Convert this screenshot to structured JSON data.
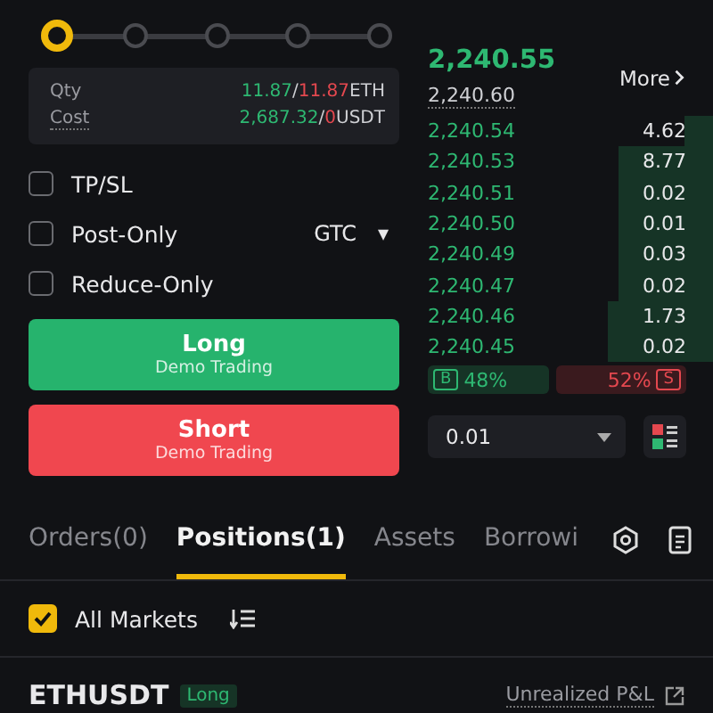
{
  "leverage_slider": {
    "level": 0
  },
  "summary": {
    "rows": [
      {
        "label": "Qty",
        "long": "11.87",
        "sep": "/",
        "short": "11.87",
        "unit": "ETH"
      },
      {
        "label": "Cost",
        "long": "2,687.32",
        "sep": "/",
        "short": "0",
        "unit": "USDT"
      }
    ]
  },
  "options": [
    {
      "label": "TP/SL",
      "checked": false
    },
    {
      "label": "Post-Only",
      "checked": false,
      "select": {
        "value": "GTC",
        "caret": "▾"
      }
    },
    {
      "label": "Reduce-Only",
      "checked": false
    }
  ],
  "actions": [
    {
      "kind": "long",
      "label": "Long",
      "sublabel": "Demo Trading"
    },
    {
      "kind": "short",
      "label": "Short",
      "sublabel": "Demo Trading"
    }
  ],
  "order_book": {
    "last_price": "2,240.55",
    "mark_price": "2,240.60",
    "more": "More",
    "bids": [
      {
        "price": "2,240.54",
        "qty": "4.62"
      },
      {
        "price": "2,240.53",
        "qty": "8.77"
      },
      {
        "price": "2,240.51",
        "qty": "0.02"
      },
      {
        "price": "2,240.50",
        "qty": "0.01"
      },
      {
        "price": "2,240.49",
        "qty": "0.03"
      },
      {
        "price": "2,240.47",
        "qty": "0.02"
      },
      {
        "price": "2,240.46",
        "qty": "1.73"
      },
      {
        "price": "2,240.45",
        "qty": "0.02"
      }
    ],
    "ratio": {
      "buy_tag": "B",
      "buy": "48%",
      "sell": "52%",
      "sell_tag": "S",
      "level": 0.48
    },
    "precision": "0.01"
  },
  "tabs": [
    {
      "label": "Orders(0)",
      "selected": false
    },
    {
      "label": "Positions(1)",
      "selected": true
    },
    {
      "label": "Assets",
      "selected": false
    },
    {
      "label": "Borrowi",
      "selected": false
    }
  ],
  "filter": {
    "label": "All Markets",
    "checked": true
  },
  "position": {
    "symbol": "ETHUSDT",
    "side": "Long",
    "pnl_label": "Unrealized P&L"
  }
}
